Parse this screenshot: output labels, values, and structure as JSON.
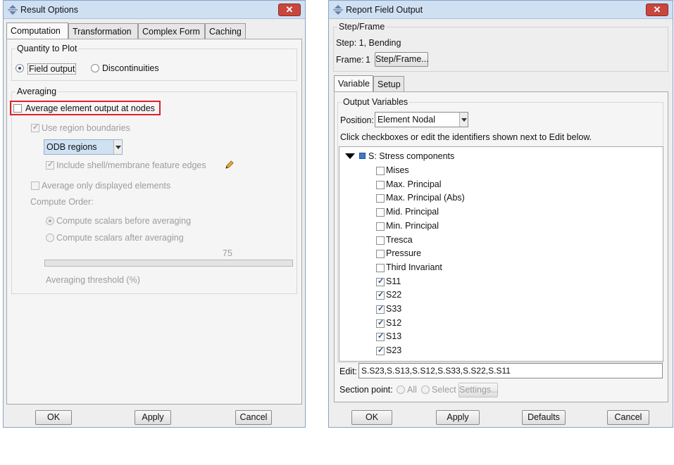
{
  "result_options": {
    "title": "Result Options",
    "close": "✕",
    "tabs": [
      "Computation",
      "Transformation",
      "Complex Form",
      "Caching"
    ],
    "quantity_to_plot": {
      "heading": "Quantity to Plot",
      "field_output": "Field output",
      "discontinuities": "Discontinuities"
    },
    "averaging": {
      "heading": "Averaging",
      "average_nodes": "Average element output at nodes",
      "use_region_boundaries": "Use region boundaries",
      "region_combo": "ODB regions",
      "include_shell": "Include shell/membrane feature edges",
      "average_displayed": "Average only displayed elements",
      "compute_order": "Compute Order:",
      "before": "Compute scalars before averaging",
      "after": "Compute scalars after averaging",
      "threshold_value": "75",
      "threshold_label": "Averaging threshold (%)"
    },
    "buttons": {
      "ok": "OK",
      "apply": "Apply",
      "cancel": "Cancel"
    }
  },
  "report_field_output": {
    "title": "Report Field Output",
    "close": "✕",
    "step_frame": {
      "heading": "Step/Frame",
      "step": "Step: 1, Bending",
      "frame_label": "Frame:",
      "frame_value": "1",
      "button": "Step/Frame..."
    },
    "tabs": [
      "Variable",
      "Setup"
    ],
    "output_variables": {
      "heading": "Output Variables",
      "position_label": "Position:",
      "position_value": "Element Nodal",
      "hint": "Click checkboxes or edit the identifiers shown next to Edit below.",
      "tree_root": "S: Stress components",
      "items": [
        {
          "label": "Mises",
          "checked": false
        },
        {
          "label": "Max. Principal",
          "checked": false
        },
        {
          "label": "Max. Principal (Abs)",
          "checked": false
        },
        {
          "label": "Mid. Principal",
          "checked": false
        },
        {
          "label": "Min. Principal",
          "checked": false
        },
        {
          "label": "Tresca",
          "checked": false
        },
        {
          "label": "Pressure",
          "checked": false
        },
        {
          "label": "Third Invariant",
          "checked": false
        },
        {
          "label": "S11",
          "checked": true
        },
        {
          "label": "S22",
          "checked": true
        },
        {
          "label": "S33",
          "checked": true
        },
        {
          "label": "S12",
          "checked": true
        },
        {
          "label": "S13",
          "checked": true
        },
        {
          "label": "S23",
          "checked": true
        }
      ]
    },
    "edit_label": "Edit:",
    "edit_value": "S.S23,S.S13,S.S12,S.S33,S.S22,S.S11",
    "section_point": {
      "label": "Section point:",
      "all": "All",
      "select": "Select",
      "settings": "Settings..."
    },
    "buttons": {
      "ok": "OK",
      "apply": "Apply",
      "defaults": "Defaults",
      "cancel": "Cancel"
    }
  },
  "colors": {
    "highlight": "#e0202a",
    "titlebar": "#cfe0f3",
    "close": "#c9463d"
  }
}
